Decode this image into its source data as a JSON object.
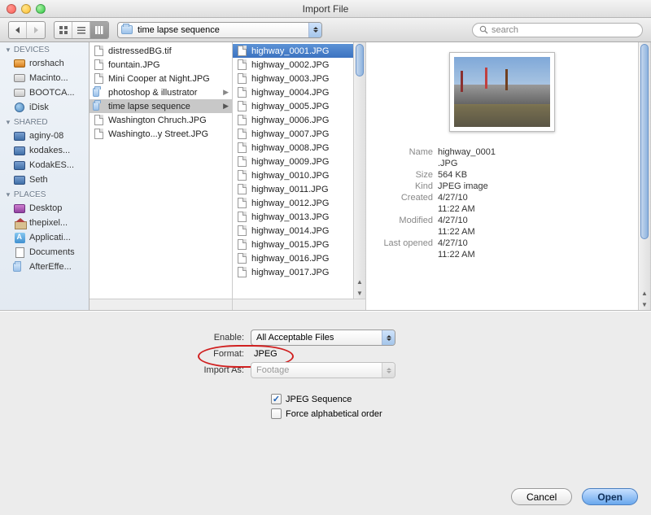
{
  "window": {
    "title": "Import File"
  },
  "toolbar": {
    "path": "time lapse sequence",
    "search_placeholder": "search"
  },
  "sidebar": {
    "sections": [
      {
        "title": "DEVICES",
        "items": [
          {
            "label": "rorshach",
            "icon": "hd-orange"
          },
          {
            "label": "Macinto...",
            "icon": "hd"
          },
          {
            "label": "BOOTCA...",
            "icon": "hd"
          },
          {
            "label": "iDisk",
            "icon": "globe"
          }
        ]
      },
      {
        "title": "SHARED",
        "items": [
          {
            "label": "aginy-08",
            "icon": "mon"
          },
          {
            "label": "kodakes...",
            "icon": "mon"
          },
          {
            "label": "KodakES...",
            "icon": "mon"
          },
          {
            "label": "Seth",
            "icon": "mon"
          }
        ]
      },
      {
        "title": "PLACES",
        "items": [
          {
            "label": "Desktop",
            "icon": "desk"
          },
          {
            "label": "thepixel...",
            "icon": "home"
          },
          {
            "label": "Applicati...",
            "icon": "app"
          },
          {
            "label": "Documents",
            "icon": "doc"
          },
          {
            "label": "AfterEffe...",
            "icon": "folder"
          }
        ]
      }
    ]
  },
  "column1": [
    {
      "name": "distressedBG.tif",
      "type": "file"
    },
    {
      "name": "fountain.JPG",
      "type": "file"
    },
    {
      "name": "Mini Cooper at Night.JPG",
      "type": "file"
    },
    {
      "name": "photoshop & illustrator",
      "type": "folder",
      "expand": true
    },
    {
      "name": "time lapse sequence",
      "type": "folder",
      "expand": true,
      "selected": true
    },
    {
      "name": "Washington Chruch.JPG",
      "type": "file"
    },
    {
      "name": "Washingto...y Street.JPG",
      "type": "file"
    }
  ],
  "column2": [
    {
      "name": "highway_0001.JPG",
      "selected": true
    },
    {
      "name": "highway_0002.JPG"
    },
    {
      "name": "highway_0003.JPG"
    },
    {
      "name": "highway_0004.JPG"
    },
    {
      "name": "highway_0005.JPG"
    },
    {
      "name": "highway_0006.JPG"
    },
    {
      "name": "highway_0007.JPG"
    },
    {
      "name": "highway_0008.JPG"
    },
    {
      "name": "highway_0009.JPG"
    },
    {
      "name": "highway_0010.JPG"
    },
    {
      "name": "highway_0011.JPG"
    },
    {
      "name": "highway_0012.JPG"
    },
    {
      "name": "highway_0013.JPG"
    },
    {
      "name": "highway_0014.JPG"
    },
    {
      "name": "highway_0015.JPG"
    },
    {
      "name": "highway_0016.JPG"
    },
    {
      "name": "highway_0017.JPG"
    }
  ],
  "preview": {
    "meta": [
      {
        "k": "Name",
        "v": "highway_0001"
      },
      {
        "k": "",
        "v": ".JPG"
      },
      {
        "k": "Size",
        "v": "564 KB"
      },
      {
        "k": "Kind",
        "v": "JPEG image"
      },
      {
        "k": "Created",
        "v": "4/27/10"
      },
      {
        "k": "",
        "v": "11:22 AM"
      },
      {
        "k": "Modified",
        "v": "4/27/10"
      },
      {
        "k": "",
        "v": "11:22 AM"
      },
      {
        "k": "Last opened",
        "v": "4/27/10"
      },
      {
        "k": "",
        "v": "11:22 AM"
      }
    ]
  },
  "bottom": {
    "enable_label": "Enable:",
    "enable_value": "All Acceptable Files",
    "format_label": "Format:",
    "format_value": "JPEG",
    "importas_label": "Import As:",
    "importas_value": "Footage",
    "jpeg_sequence": "JPEG Sequence",
    "force_alpha": "Force alphabetical order",
    "cancel": "Cancel",
    "open": "Open"
  }
}
